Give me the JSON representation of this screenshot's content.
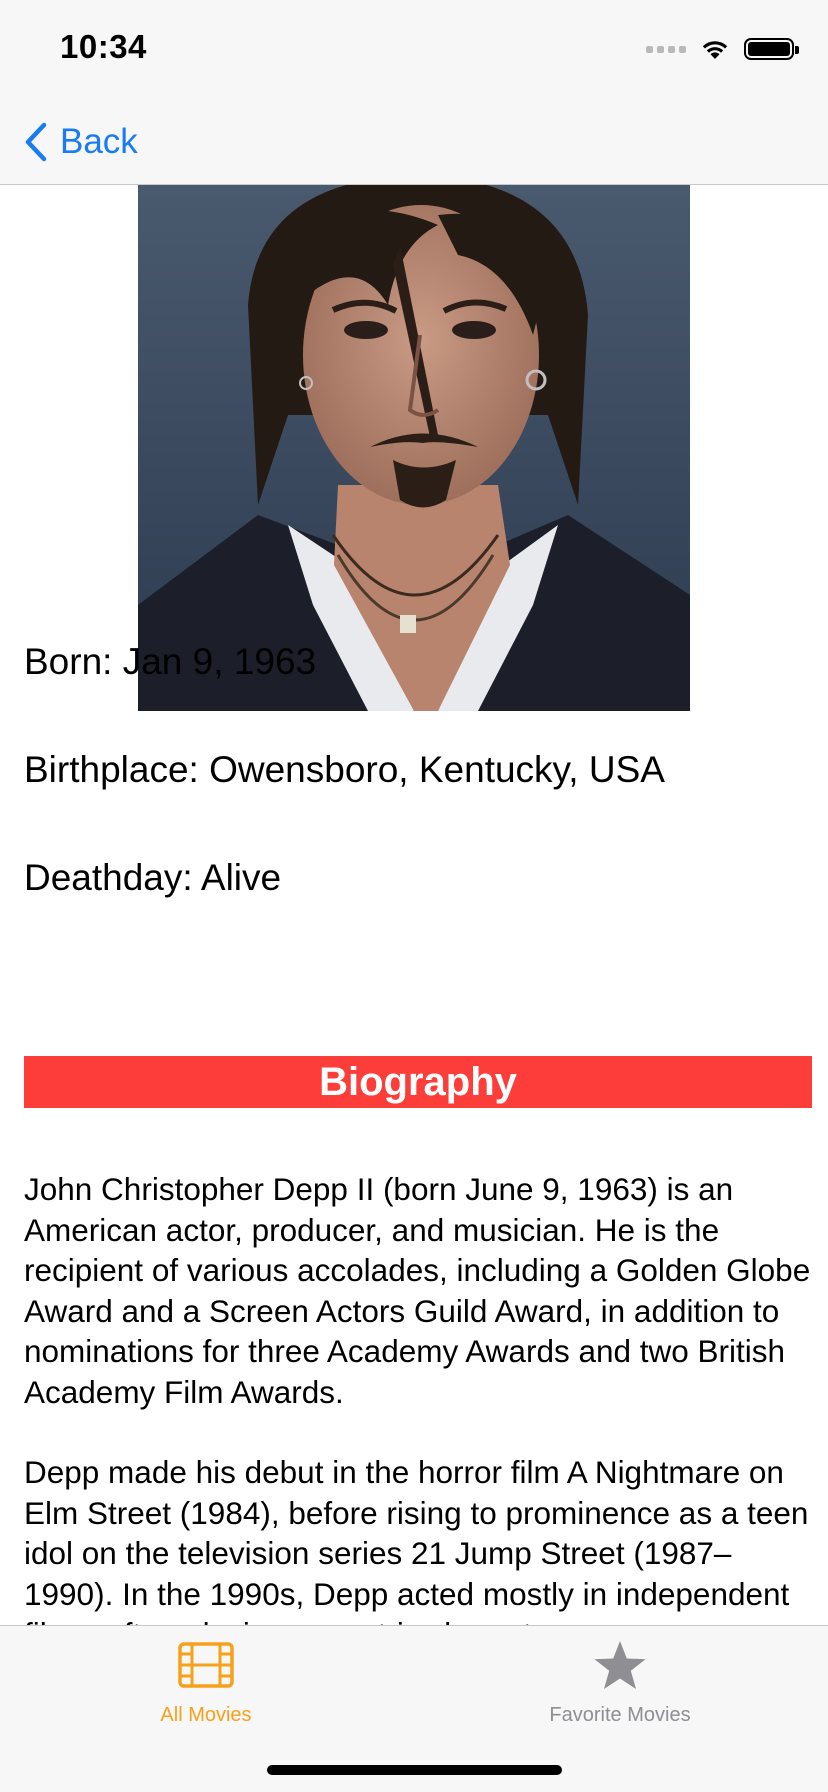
{
  "status_bar": {
    "time": "10:34"
  },
  "nav": {
    "back_label": "Back",
    "back_icon": "chevron-left-icon",
    "accent_color": "#1a7cf5"
  },
  "person": {
    "photo_alt": "Johnny Depp portrait",
    "born": "Born: Jan 9, 1963",
    "birthplace": "Birthplace: Owensboro, Kentucky, USA",
    "deathday": "Deathday: Alive"
  },
  "biography": {
    "header": "Biography",
    "header_color": "#fc3d39",
    "paragraph_1": "John Christopher Depp II (born June 9, 1963) is an American actor, producer, and musician. He is the recipient of various accolades, including a Golden Globe Award and a Screen Actors Guild Award, in addition to nominations for three Academy Awards and two British Academy Film Awards.",
    "paragraph_2": "Depp made his debut in the horror film A Nightmare on Elm Street (1984), before rising to prominence as a teen idol on the television series 21 Jump Street (1987–1990). In the 1990s, Depp acted mostly in independent films, often playing eccentric characters."
  },
  "tab_bar": {
    "tabs": [
      {
        "label": "All Movies",
        "icon": "film-icon",
        "selected": true,
        "color": "#f5a11b"
      },
      {
        "label": "Favorite Movies",
        "icon": "star-icon",
        "selected": false,
        "color": "#8e8e93"
      }
    ]
  }
}
